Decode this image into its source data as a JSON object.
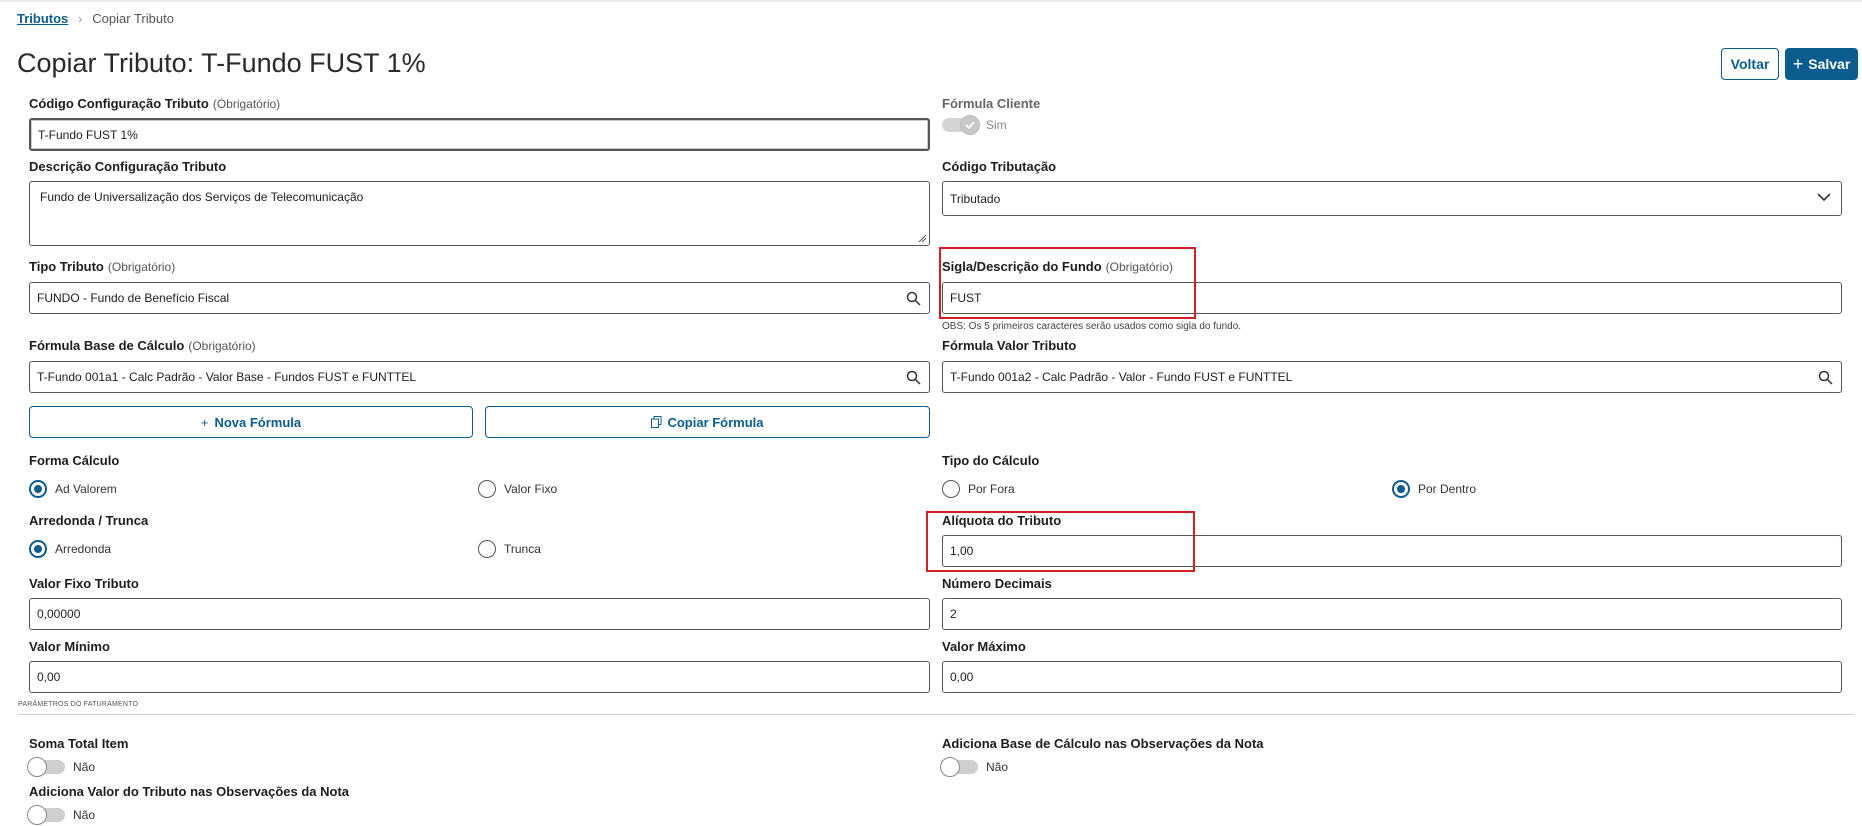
{
  "breadcrumb": {
    "parent": "Tributos",
    "current": "Copiar Tributo"
  },
  "page": {
    "title": "Copiar Tributo: T-Fundo FUST 1%"
  },
  "actions": {
    "back": "Voltar",
    "save": "Salvar"
  },
  "required_label": "(Obrigatório)",
  "fields": {
    "codigo_config": {
      "label": "Código Configuração Tributo",
      "value": "T-Fundo FUST 1%"
    },
    "formula_cliente": {
      "label": "Fórmula Cliente",
      "state": "Sim"
    },
    "descricao_config": {
      "label": "Descrição Configuração Tributo",
      "value": "Fundo de Universalização dos Serviços de Telecomunicação"
    },
    "codigo_tributacao": {
      "label": "Código Tributação",
      "value": "Tributado"
    },
    "tipo_tributo": {
      "label": "Tipo Tributo",
      "value": "FUNDO - Fundo de Benefício Fiscal"
    },
    "sigla_fundo": {
      "label": "Sigla/Descrição do Fundo",
      "value": "FUST",
      "note": "OBS: Os 5 primeiros caracteres serão usados como sigla do fundo."
    },
    "formula_base": {
      "label": "Fórmula Base de Cálculo",
      "value": "T-Fundo 001a1 - Calc Padrão - Valor Base - Fundos FUST e FUNTTEL"
    },
    "formula_valor": {
      "label": "Fórmula Valor Tributo",
      "value": "T-Fundo 001a2 - Calc Padrão - Valor - Fundo FUST e FUNTTEL"
    },
    "aliquota": {
      "label": "Alíquota do Tributo",
      "value": "1,00"
    },
    "valor_fixo": {
      "label": "Valor Fixo Tributo",
      "value": "0,00000"
    },
    "numero_decimais": {
      "label": "Número Decimais",
      "value": "2"
    },
    "valor_minimo": {
      "label": "Valor Mínimo",
      "value": "0,00"
    },
    "valor_maximo": {
      "label": "Valor Máximo",
      "value": "0,00"
    }
  },
  "formula_buttons": {
    "nova": "Nova Fórmula",
    "copiar": "Copiar Fórmula"
  },
  "forma_calculo": {
    "label": "Forma Cálculo",
    "options": [
      "Ad Valorem",
      "Valor Fixo"
    ],
    "selected": "Ad Valorem"
  },
  "tipo_calculo": {
    "label": "Tipo do Cálculo",
    "options": [
      "Por Fora",
      "Por Dentro"
    ],
    "selected": "Por Dentro"
  },
  "arredonda": {
    "label": "Arredonda / Trunca",
    "options": [
      "Arredonda",
      "Trunca"
    ],
    "selected": "Arredonda"
  },
  "section_faturamento": "PARÂMETROS DO FATURAMENTO",
  "toggles": {
    "soma_total": {
      "label": "Soma Total Item",
      "state": "Não"
    },
    "adiciona_base": {
      "label": "Adiciona Base de Cálculo nas Observações da Nota",
      "state": "Não"
    },
    "adiciona_valor": {
      "label": "Adiciona Valor do Tributo nas Observações da Nota",
      "state": "Não"
    }
  },
  "colors": {
    "accent": "#0c5c8f",
    "highlight": "#d11f24"
  }
}
